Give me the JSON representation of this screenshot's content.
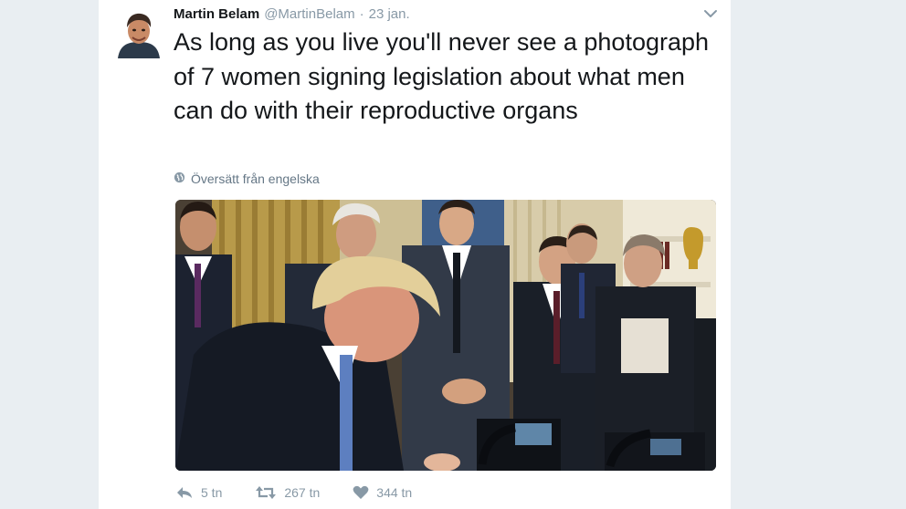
{
  "tweet": {
    "author_name": "Martin Belam",
    "author_handle": "@MartinBelam",
    "separator": "·",
    "date": "23 jan.",
    "text": "As long as you live you'll never see a photograph of 7 women signing legislation about what men can do with their reproductive organs",
    "translate_label": "Översätt från engelska"
  },
  "actions": {
    "reply_count": "5 tn",
    "retweet_count": "267 tn",
    "like_count": "344 tn"
  },
  "icons": {
    "caret": "chevron-down-icon",
    "translate": "globe-icon",
    "reply": "reply-icon",
    "retweet": "retweet-icon",
    "like": "heart-icon"
  },
  "colors": {
    "text": "#14171a",
    "muted": "#8899a6",
    "background": "#e9eef2",
    "card": "#ffffff"
  }
}
